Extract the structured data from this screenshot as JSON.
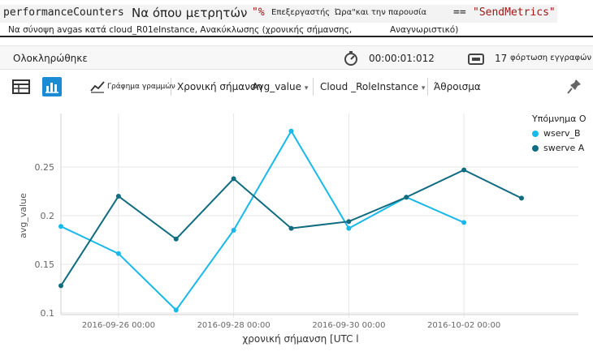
{
  "query": {
    "line1": {
      "table": "performanceCounters",
      "where_text": "Να όπου μετρητών",
      "percent": "\"%",
      "counter_name": "Επεξεργαστής",
      "time_label": "Ώρα\"και την παρουσία",
      "op": "==",
      "value": "\"SendMetrics\""
    },
    "line2": {
      "summarize_text": "Να σύνοψη avgas κατά cloud_R01eInstance, Ανακύκλωσης (χρονικής σήμανσης,",
      "ident_text": "Αναγνωριστικό)"
    }
  },
  "status": {
    "state": "Ολοκληρώθηκε",
    "duration": "00:00:01:012",
    "records_count": "17",
    "records_label": "φόρτωση εγγραφών"
  },
  "toolbar": {
    "chart_type": "Γράφημα γραμμών",
    "x_field": "Χρονική σήμανση",
    "y_field": "Avg_value",
    "split_field": "Cloud _RoleInstance",
    "aggregation": "Άθροισμα"
  },
  "colors": {
    "wserv": "#18b9ea",
    "swerve": "#116c7f",
    "grid": "#e6e6e6",
    "axis_text": "#666666"
  },
  "legend": {
    "title": "Υπόμνημα Ο",
    "items": [
      "wserv_B",
      "swerve A"
    ]
  },
  "chart_data": {
    "type": "line",
    "xlabel": "χρονική σήμανση [UTC l",
    "ylabel": "avg_value",
    "ylim": [
      0.1,
      0.3
    ],
    "xlim": [
      "2016-09-25",
      "2016-10-03"
    ],
    "yticks": [
      "0.1",
      "0.15",
      "0.2",
      "0.25"
    ],
    "xticks": [
      "2016-09-26 00:00",
      "2016-09-28 00:00",
      "2016-09-30 00:00",
      "2016-10-02 00:00"
    ],
    "grid": true,
    "legend_position": "top-right",
    "series": [
      {
        "name": "wserv_B",
        "color": "#18b9ea",
        "points": [
          [
            "2016-09-25",
            0.189
          ],
          [
            "2016-09-26",
            0.161
          ],
          [
            "2016-09-27",
            0.103
          ],
          [
            "2016-09-28",
            0.185
          ],
          [
            "2016-09-29",
            0.287
          ],
          [
            "2016-09-30",
            0.187
          ],
          [
            "2016-10-01",
            0.219
          ],
          [
            "2016-10-02",
            0.193
          ]
        ]
      },
      {
        "name": "swerve A",
        "color": "#116c7f",
        "points": [
          [
            "2016-09-25",
            0.128
          ],
          [
            "2016-09-26",
            0.22
          ],
          [
            "2016-09-27",
            0.176
          ],
          [
            "2016-09-28",
            0.238
          ],
          [
            "2016-09-29",
            0.187
          ],
          [
            "2016-09-30",
            0.194
          ],
          [
            "2016-10-01",
            0.219
          ],
          [
            "2016-10-02",
            0.247
          ],
          [
            "2016-10-03",
            0.218
          ]
        ]
      }
    ]
  }
}
